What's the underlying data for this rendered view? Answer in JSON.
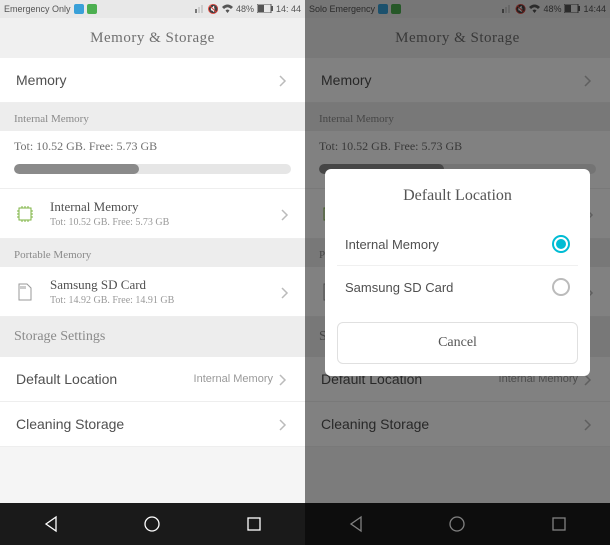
{
  "statusbar": {
    "left_network": "Emergency Only",
    "left_battery": "48%",
    "left_time": "14: 44",
    "right_network": "Solo Emergency",
    "right_battery": "48%",
    "right_time": "14:44"
  },
  "header": {
    "title": "Memory & Storage"
  },
  "rows": {
    "memory": "Memory"
  },
  "sections": {
    "internal": "Internal Memory",
    "portable": "Portable Memory",
    "storage_settings": "Storage Settings"
  },
  "internal": {
    "stats": "Tot: 10.52 GB. Free: 5.73 GB",
    "item_title": "Internal Memory",
    "item_sub": "Tot: 10.52 GB. Free: 5.73 GB",
    "used_pct": 45
  },
  "portable": {
    "item_title": "Samsung SD Card",
    "item_sub": "Tot: 14.92 GB. Free: 14.91 GB"
  },
  "settings": {
    "default_location": "Default Location",
    "default_value": "Internal Memory",
    "cleaning": "Cleaning Storage"
  },
  "dialog": {
    "title": "Default Location",
    "opt1": "Internal Memory",
    "opt2": "Samsung SD Card",
    "cancel": "Cancel"
  }
}
